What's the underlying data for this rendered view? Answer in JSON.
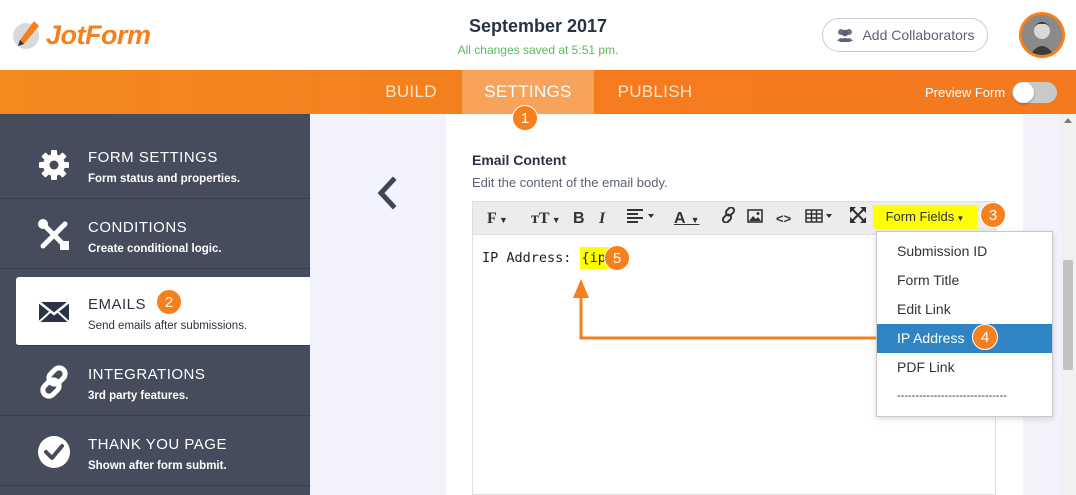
{
  "header": {
    "brand": "JotForm",
    "title": "September 2017",
    "saved_status": "All changes saved at 5:51 pm.",
    "collab_label": "Add Collaborators"
  },
  "nav": {
    "tabs": [
      {
        "label": "BUILD"
      },
      {
        "label": "SETTINGS",
        "active": true
      },
      {
        "label": "PUBLISH"
      }
    ],
    "preview_label": "Preview Form"
  },
  "steps": [
    "1",
    "2",
    "3",
    "4",
    "5"
  ],
  "sidebar": {
    "items": [
      {
        "title": "FORM SETTINGS",
        "desc": "Form status and properties.",
        "icon": "gear-icon"
      },
      {
        "title": "CONDITIONS",
        "desc": "Create conditional logic.",
        "icon": "conditions-icon"
      },
      {
        "title": "EMAILS",
        "desc": "Send emails after submissions.",
        "icon": "envelope-icon",
        "active": true
      },
      {
        "title": "INTEGRATIONS",
        "desc": "3rd party features.",
        "icon": "link-icon"
      },
      {
        "title": "THANK YOU PAGE",
        "desc": "Shown after form submit.",
        "icon": "check-circle-icon"
      }
    ]
  },
  "email": {
    "heading": "Email Content",
    "subheading": "Edit the content of the email body.",
    "toolbar": {
      "font": "F",
      "size": "тT",
      "bold": "B",
      "italic": "I",
      "color": "A",
      "code": "<>",
      "form_fields": "Form Fields"
    },
    "body_label": "IP Address: ",
    "body_tag": "{ip}"
  },
  "dropdown": {
    "items": [
      {
        "label": "Submission ID"
      },
      {
        "label": "Form Title"
      },
      {
        "label": "Edit Link"
      },
      {
        "label": "IP Address",
        "selected": true
      },
      {
        "label": "PDF Link"
      },
      {
        "label": "------------------------------"
      }
    ]
  },
  "colors": {
    "accent": "#f7801e",
    "sidebar": "#464c5c",
    "highlight": "#ffff00",
    "selected": "#2f85c4"
  }
}
